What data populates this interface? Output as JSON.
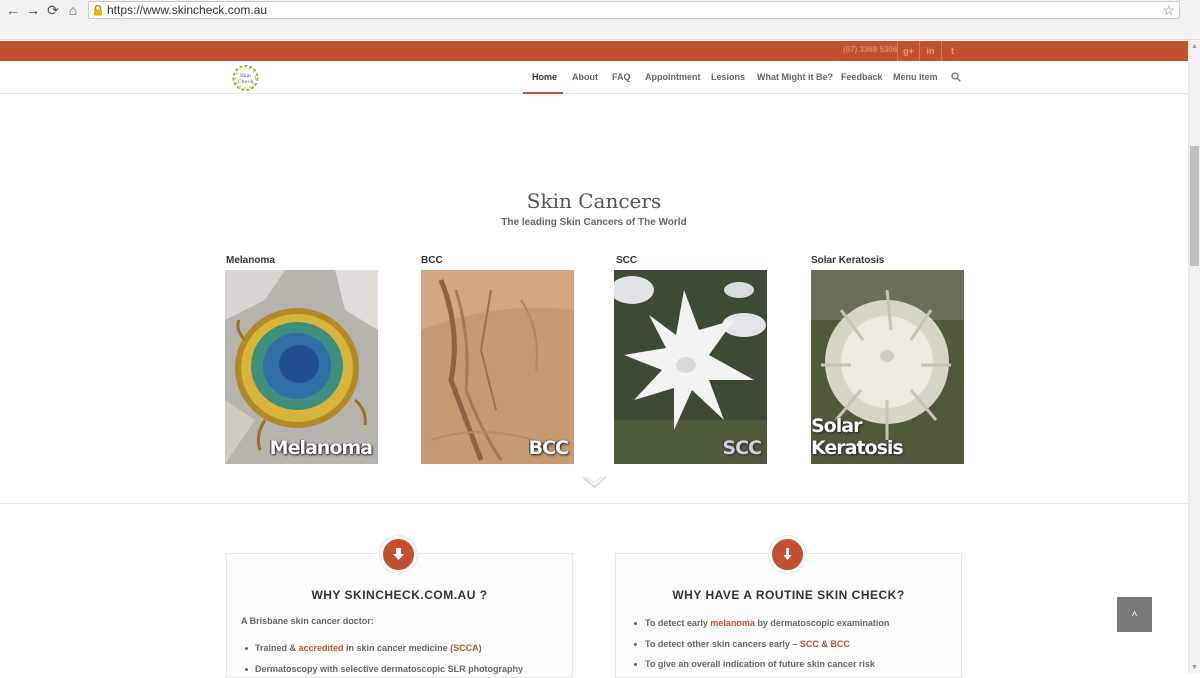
{
  "browser": {
    "url": "https://www.skincheck.com.au",
    "back": "←",
    "forward": "→",
    "reload": "⟳",
    "home": "⌂",
    "bookmark": "☆"
  },
  "topbar": {
    "phone": "(07) 3369 5306",
    "social": [
      "g+",
      "in",
      "t"
    ]
  },
  "logo": {
    "line1": "Skin",
    "line2": "Check"
  },
  "menu": [
    "Home",
    "About",
    "FAQ",
    "Appointment",
    "Lesions",
    "What Might it Be?",
    "Feedback",
    "Menu Item"
  ],
  "hero": {
    "title": "Skin Cancers",
    "subtitle": "The leading Skin Cancers of The World"
  },
  "cards": [
    {
      "label": "Melanoma",
      "caption": "Melanoma"
    },
    {
      "label": "BCC",
      "caption": "BCC"
    },
    {
      "label": "SCC",
      "caption": "SCC"
    },
    {
      "label": "Solar Keratosis",
      "caption": "Solar Keratosis"
    }
  ],
  "why": {
    "title": "WHY SKINCHECK.COM.AU ?",
    "intro": "A Brisbane skin cancer doctor:",
    "item1_pre": "Trained & ",
    "item1_link": "accredited",
    "item1_mid": " in skin cancer medicine (",
    "item1_link2": "SCCA",
    "item1_post": ")",
    "item2": "Dermatoscopy with selective dermatoscopic SLR photography"
  },
  "routine": {
    "title": "WHY HAVE A ROUTINE SKIN CHECK?",
    "item1_pre": "To detect early ",
    "item1_link": "melanoma",
    "item1_post": " by dermatoscopic examination",
    "item2_pre": "To detect other skin cancers early – ",
    "item2_link1": "SCC",
    "item2_mid": " & ",
    "item2_link2": "BCC",
    "item3": "To give an overall indication of future skin cancer risk"
  },
  "to_top": "˄",
  "colors": {
    "accent": "#c3512f"
  }
}
